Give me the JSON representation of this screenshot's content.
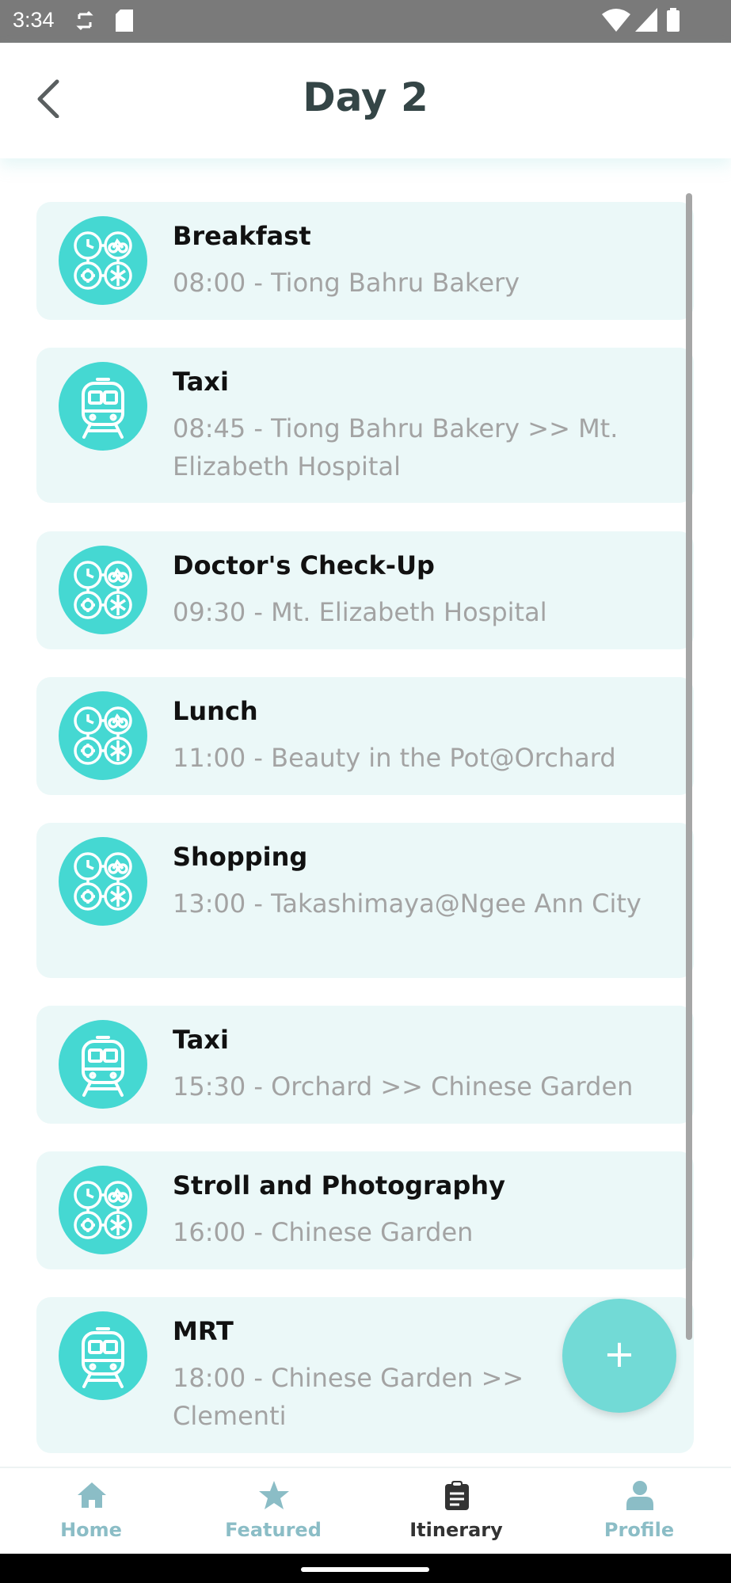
{
  "status_bar": {
    "time": "3:34"
  },
  "header": {
    "title": "Day 2"
  },
  "items": [
    {
      "title": "Breakfast",
      "subtitle": "08:00 - Tiong Bahru Bakery",
      "icon": "activity-icon"
    },
    {
      "title": "Taxi",
      "subtitle": "08:45 - Tiong Bahru Bakery >> Mt. Elizabeth Hospital",
      "icon": "train-icon"
    },
    {
      "title": "Doctor's Check-Up",
      "subtitle": "09:30 - Mt. Elizabeth Hospital",
      "icon": "activity-icon"
    },
    {
      "title": "Lunch",
      "subtitle": "11:00 - Beauty in the Pot@Orchard",
      "icon": "activity-icon"
    },
    {
      "title": "Shopping",
      "subtitle": "13:00 - Takashimaya@Ngee Ann City",
      "icon": "activity-icon"
    },
    {
      "title": "Taxi",
      "subtitle": "15:30 - Orchard >> Chinese Garden",
      "icon": "train-icon"
    },
    {
      "title": "Stroll and Photography",
      "subtitle": "16:00 - Chinese Garden",
      "icon": "activity-icon"
    },
    {
      "title": "MRT",
      "subtitle": "18:00 - Chinese Garden >> Clementi",
      "icon": "train-icon"
    }
  ],
  "fab": {
    "label": "+"
  },
  "nav": {
    "tabs": [
      {
        "label": "Home",
        "icon": "home-icon",
        "active": false
      },
      {
        "label": "Featured",
        "icon": "star-icon",
        "active": false
      },
      {
        "label": "Itinerary",
        "icon": "clipboard-icon",
        "active": true
      },
      {
        "label": "Profile",
        "icon": "person-icon",
        "active": false
      }
    ]
  },
  "colors": {
    "accent": "#45d8d2",
    "card_bg": "#ebf8f8",
    "title_text": "#344546",
    "inactive_tab": "#8bbdc6",
    "active_tab": "#333333"
  }
}
